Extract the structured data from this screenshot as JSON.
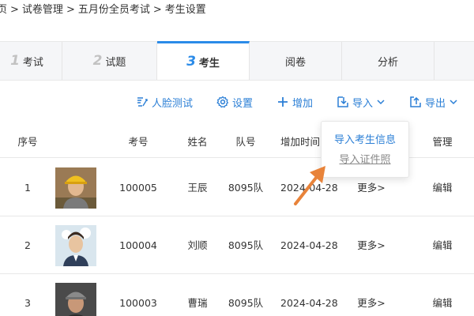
{
  "breadcrumb": [
    "页",
    "试卷管理",
    "五月份全员考试",
    "考生设置"
  ],
  "breadcrumb_sep": ">",
  "tabs": [
    {
      "num": "1",
      "label": "考试"
    },
    {
      "num": "2",
      "label": "试题"
    },
    {
      "num": "3",
      "label": "考生"
    },
    {
      "num": "",
      "label": "阅卷"
    },
    {
      "num": "",
      "label": "分析"
    }
  ],
  "active_tab": 2,
  "toolbar": {
    "face_test": "人脸测试",
    "settings": "设置",
    "add": "增加",
    "import": "导入",
    "export": "导出"
  },
  "dropdown": {
    "import_info": "导入考生信息",
    "import_photo": "导入证件照"
  },
  "table": {
    "headers": [
      "序号",
      "考号",
      "姓名",
      "队号",
      "增加时间",
      "管理"
    ],
    "rows": [
      {
        "index": "1",
        "exam_no": "100005",
        "name": "王辰",
        "team": "8095队",
        "date": "2024-04-28",
        "more": "更多>",
        "edit": "编辑"
      },
      {
        "index": "2",
        "exam_no": "100004",
        "name": "刘顺",
        "team": "8095队",
        "date": "2024-04-28",
        "more": "更多>",
        "edit": "编辑"
      },
      {
        "index": "3",
        "exam_no": "100003",
        "name": "曹瑞",
        "team": "8095队",
        "date": "2024-04-28",
        "more": "更多>",
        "edit": "编辑"
      }
    ]
  },
  "colors": {
    "accent": "#2b8be8",
    "link": "#2b7fd6",
    "arrow": "#e8833a"
  }
}
